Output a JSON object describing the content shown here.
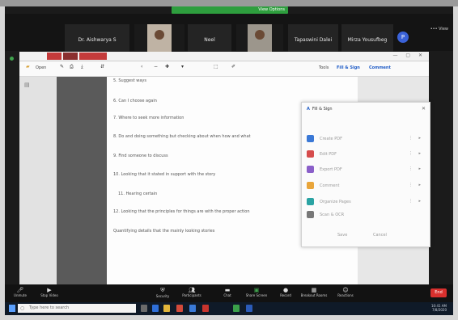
{
  "meeting": {
    "share_banner": "View Options",
    "participants": [
      "Dr. Aishwarya S",
      "",
      "Neel",
      "",
      "Tapaswini Dalei",
      "Mirza Yousufbeg"
    ],
    "self_initial": "P",
    "top_right": "••• View"
  },
  "app": {
    "title_buttons": [
      "",
      "",
      ""
    ],
    "title_text": "",
    "window_controls": "— ▢ ✕"
  },
  "toolbar": {
    "open_label": "Open",
    "tools": "Tools",
    "fill_sign": "Fill & Sign",
    "comment": "Comment"
  },
  "document": {
    "lines": [
      "5. Suggest ways",
      "6. Can I choose again",
      "7. Where to seek more information",
      "8. Do and doing something but checking about when how and what",
      "9. Find someone to discuss",
      "10. Looking that it stated in support with the story",
      "11. Hearing certain",
      "12. Looking that the principles for things are with the proper action",
      "Quantifying details that the mainly looking stories"
    ]
  },
  "right_panel": {
    "brand": "A",
    "title": "Fill & Sign",
    "items": [
      {
        "color": "#3a78d6",
        "label": "Create PDF"
      },
      {
        "color": "#d64c4c",
        "label": "Edit PDF"
      },
      {
        "color": "#8a5fc9",
        "label": "Export PDF"
      },
      {
        "color": "#e9a53a",
        "label": "Comment"
      },
      {
        "color": "#2aa3a3",
        "label": "Organize Pages"
      },
      {
        "color": "#777777",
        "label": "Scan & OCR"
      }
    ],
    "buttons": [
      "Save",
      "Cancel"
    ]
  },
  "meet_controls": {
    "left": [
      "Unmute",
      "Stop Video"
    ],
    "center": [
      "Security",
      "Participants",
      "Chat",
      "Share Screen",
      "Record",
      "Breakout Rooms",
      "Reactions"
    ],
    "end": "End"
  },
  "taskbar": {
    "search_placeholder": "Type here to search",
    "clock_time": "10:41 AM",
    "clock_date": "7/8/2020"
  }
}
